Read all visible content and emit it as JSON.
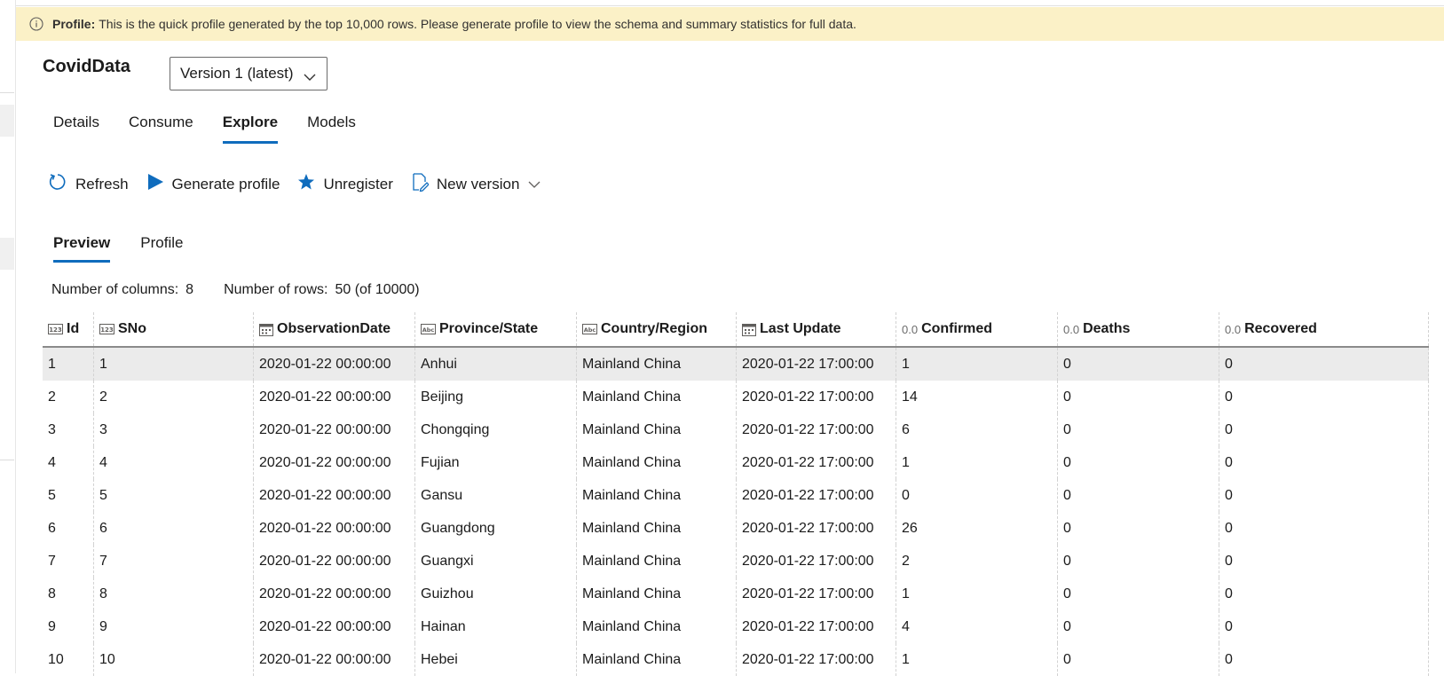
{
  "banner": {
    "label": "Profile:",
    "text": "This is the quick profile generated by the top 10,000 rows. Please generate profile to view the schema and summary statistics for full data."
  },
  "dataset": {
    "title": "CovidData",
    "version": "Version 1 (latest)"
  },
  "tabs": [
    {
      "label": "Details",
      "active": false
    },
    {
      "label": "Consume",
      "active": false
    },
    {
      "label": "Explore",
      "active": true
    },
    {
      "label": "Models",
      "active": false
    }
  ],
  "toolbar": {
    "refresh": "Refresh",
    "generate_profile": "Generate profile",
    "unregister": "Unregister",
    "new_version": "New version"
  },
  "subtabs": [
    {
      "label": "Preview",
      "active": true
    },
    {
      "label": "Profile",
      "active": false
    }
  ],
  "stats": {
    "columns_label": "Number of columns:",
    "columns_value": "8",
    "rows_label": "Number of rows:",
    "rows_value": "50 (of 10000)"
  },
  "table": {
    "columns": [
      {
        "name": "Id",
        "type": "int-icon"
      },
      {
        "name": "SNo",
        "type": "int-icon"
      },
      {
        "name": "ObservationDate",
        "type": "calendar-icon"
      },
      {
        "name": "Province/State",
        "type": "string-icon"
      },
      {
        "name": "Country/Region",
        "type": "string-icon"
      },
      {
        "name": "Last Update",
        "type": "calendar-icon"
      },
      {
        "name": "Confirmed",
        "type": "float-icon",
        "type_label": "0.0"
      },
      {
        "name": "Deaths",
        "type": "float-icon",
        "type_label": "0.0"
      },
      {
        "name": "Recovered",
        "type": "float-icon",
        "type_label": "0.0"
      }
    ],
    "rows": [
      [
        "1",
        "1",
        "2020-01-22 00:00:00",
        "Anhui",
        "Mainland China",
        "2020-01-22 17:00:00",
        "1",
        "0",
        "0"
      ],
      [
        "2",
        "2",
        "2020-01-22 00:00:00",
        "Beijing",
        "Mainland China",
        "2020-01-22 17:00:00",
        "14",
        "0",
        "0"
      ],
      [
        "3",
        "3",
        "2020-01-22 00:00:00",
        "Chongqing",
        "Mainland China",
        "2020-01-22 17:00:00",
        "6",
        "0",
        "0"
      ],
      [
        "4",
        "4",
        "2020-01-22 00:00:00",
        "Fujian",
        "Mainland China",
        "2020-01-22 17:00:00",
        "1",
        "0",
        "0"
      ],
      [
        "5",
        "5",
        "2020-01-22 00:00:00",
        "Gansu",
        "Mainland China",
        "2020-01-22 17:00:00",
        "0",
        "0",
        "0"
      ],
      [
        "6",
        "6",
        "2020-01-22 00:00:00",
        "Guangdong",
        "Mainland China",
        "2020-01-22 17:00:00",
        "26",
        "0",
        "0"
      ],
      [
        "7",
        "7",
        "2020-01-22 00:00:00",
        "Guangxi",
        "Mainland China",
        "2020-01-22 17:00:00",
        "2",
        "0",
        "0"
      ],
      [
        "8",
        "8",
        "2020-01-22 00:00:00",
        "Guizhou",
        "Mainland China",
        "2020-01-22 17:00:00",
        "1",
        "0",
        "0"
      ],
      [
        "9",
        "9",
        "2020-01-22 00:00:00",
        "Hainan",
        "Mainland China",
        "2020-01-22 17:00:00",
        "4",
        "0",
        "0"
      ],
      [
        "10",
        "10",
        "2020-01-22 00:00:00",
        "Hebei",
        "Mainland China",
        "2020-01-22 17:00:00",
        "1",
        "0",
        "0"
      ]
    ]
  },
  "colors": {
    "accent": "#0f6cbd",
    "banner_bg": "#fbf1c7",
    "selected_row": "#ebebeb"
  }
}
